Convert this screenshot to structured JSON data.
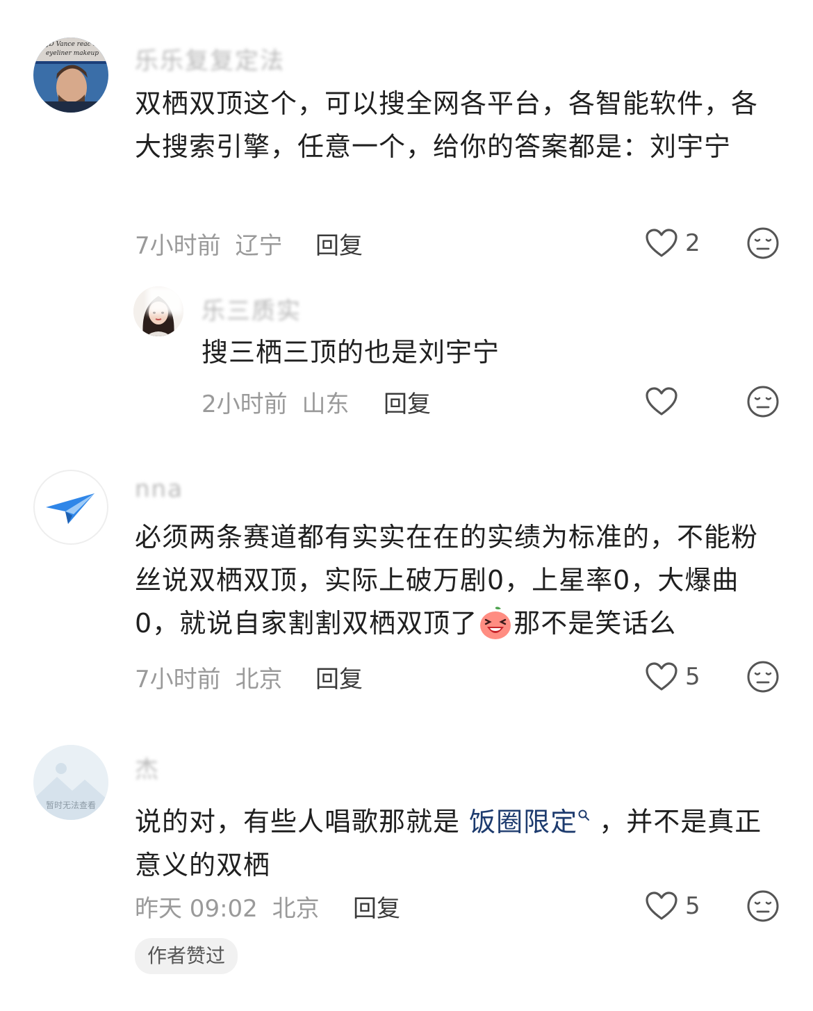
{
  "comments": [
    {
      "name": "乐乐复复定法",
      "avatar_caption": "s JD Vance reac ear eyeliner makeup",
      "text": "双栖双顶这个，可以搜全网各平台，各智能软件，各大搜索引擎，任意一个，给你的答案都是：刘宇宁",
      "time": "7小时前",
      "location": "辽宁",
      "reply_label": "回复",
      "likes": "2",
      "replies": [
        {
          "name": "乐三质实",
          "text": "搜三栖三顶的也是刘宇宁",
          "time": "2小时前",
          "location": "山东",
          "reply_label": "回复"
        }
      ]
    },
    {
      "name": "nna",
      "text_before_emoji": "必须两条赛道都有实实在在的实绩为标准的，不能粉丝说双栖双顶，实际上破万剧0，上星率0，大爆曲0，就说自家割割双栖双顶了",
      "text_after_emoji": "那不是笑话么",
      "time": "7小时前",
      "location": "北京",
      "reply_label": "回复",
      "likes": "5"
    },
    {
      "name": "杰",
      "avatar_caption": "暂时无法查看",
      "text_before_link": "说的对，有些人唱歌那就是 ",
      "link_text": "饭圈限定",
      "text_after_link": " ，并不是真正意义的双栖",
      "time": "昨天 09:02",
      "location": "北京",
      "reply_label": "回复",
      "likes": "5",
      "badge": "作者赞过"
    }
  ],
  "icons": {
    "like": "heart-outline-icon",
    "dislike": "meh-face-icon",
    "search_link": "search-icon",
    "emoji": "laughing-peach-emoji"
  },
  "colors": {
    "link": "#1d3b6e",
    "meta": "#9a9a9a",
    "icon": "#555555"
  }
}
